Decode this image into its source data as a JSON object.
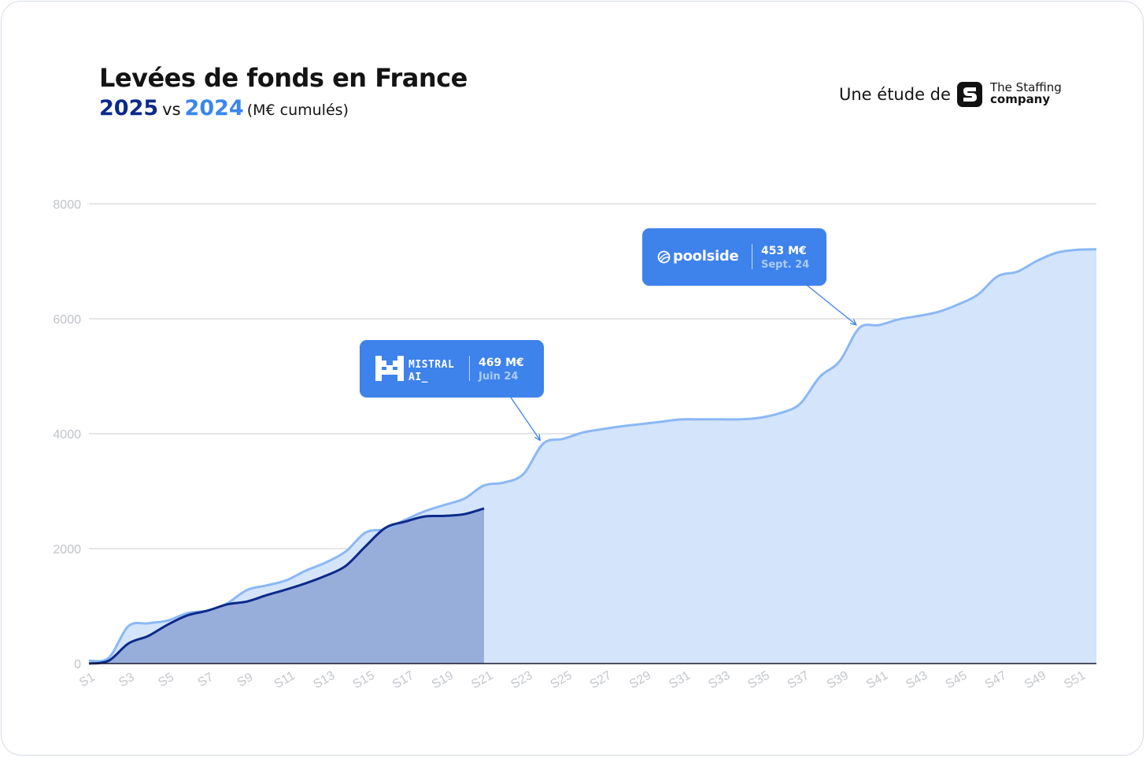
{
  "header": {
    "title": "Levées de fonds en France",
    "subtitle_year_2025": "2025",
    "subtitle_vs": "vs",
    "subtitle_year_2024": "2024",
    "subtitle_unit": "(M€ cumulés)"
  },
  "branding": {
    "prefix": "Une étude de",
    "company_line1": "The Staffing",
    "company_line2": "company",
    "logo_icon": "staffing-company-s-logo"
  },
  "colors": {
    "series_2025": "#0b2a8a",
    "series_2024": "#3a86ee",
    "area_2024": "#d4e4fb",
    "area_2025": "#93abd9",
    "annotation_bg": "#3e82ec"
  },
  "annotations": [
    {
      "company": "MISTRAL\nAI_",
      "amount": "469 M€",
      "date": "Juin 24",
      "icon": "mistral-logo-icon",
      "points_to_week": "S24"
    },
    {
      "company": "poolside",
      "amount": "453 M€",
      "date": "Sept. 24",
      "icon": "poolside-logo-icon",
      "points_to_week": "S40"
    }
  ],
  "chart_data": {
    "type": "area",
    "title": "Levées de fonds en France",
    "subtitle": "2025 vs 2024 (M€ cumulés)",
    "xlabel": "",
    "ylabel": "",
    "ylim": [
      0,
      8000
    ],
    "y_ticks": [
      "0",
      "2000",
      "4000",
      "6000",
      "8000"
    ],
    "x_tick_labels": [
      "S1",
      "S3",
      "S5",
      "S7",
      "S9",
      "S11",
      "S13",
      "S15",
      "S17",
      "S19",
      "S21",
      "S23",
      "S25",
      "S27",
      "S29",
      "S31",
      "S33",
      "S35",
      "S37",
      "S39",
      "S41",
      "S43",
      "S45",
      "S47",
      "S49",
      "S51"
    ],
    "grid": true,
    "legend": "none",
    "series": [
      {
        "name": "2024",
        "x": [
          "S1",
          "S2",
          "S3",
          "S4",
          "S5",
          "S6",
          "S7",
          "S8",
          "S9",
          "S10",
          "S11",
          "S12",
          "S13",
          "S14",
          "S15",
          "S16",
          "S17",
          "S18",
          "S19",
          "S20",
          "S21",
          "S22",
          "S23",
          "S24",
          "S25",
          "S26",
          "S27",
          "S28",
          "S29",
          "S30",
          "S31",
          "S32",
          "S33",
          "S34",
          "S35",
          "S36",
          "S37",
          "S38",
          "S39",
          "S40",
          "S41",
          "S42",
          "S43",
          "S44",
          "S45",
          "S46",
          "S47",
          "S48",
          "S49",
          "S50",
          "S51",
          "S52"
        ],
        "values": [
          50,
          100,
          650,
          700,
          750,
          880,
          920,
          1050,
          1280,
          1360,
          1450,
          1620,
          1760,
          1950,
          2280,
          2340,
          2500,
          2650,
          2760,
          2870,
          3100,
          3150,
          3300,
          3830,
          3910,
          4020,
          4080,
          4130,
          4170,
          4210,
          4250,
          4250,
          4250,
          4250,
          4280,
          4360,
          4520,
          4990,
          5260,
          5840,
          5890,
          5990,
          6050,
          6120,
          6250,
          6420,
          6740,
          6820,
          7010,
          7150,
          7200,
          7210
        ]
      },
      {
        "name": "2025",
        "x": [
          "S1",
          "S2",
          "S3",
          "S4",
          "S5",
          "S6",
          "S7",
          "S8",
          "S9",
          "S10",
          "S11",
          "S12",
          "S13",
          "S14",
          "S15",
          "S16",
          "S17",
          "S18",
          "S19",
          "S20",
          "S21"
        ],
        "values": [
          0,
          50,
          350,
          480,
          680,
          840,
          920,
          1030,
          1080,
          1190,
          1290,
          1400,
          1530,
          1700,
          2040,
          2360,
          2470,
          2560,
          2570,
          2600,
          2700
        ]
      }
    ]
  }
}
